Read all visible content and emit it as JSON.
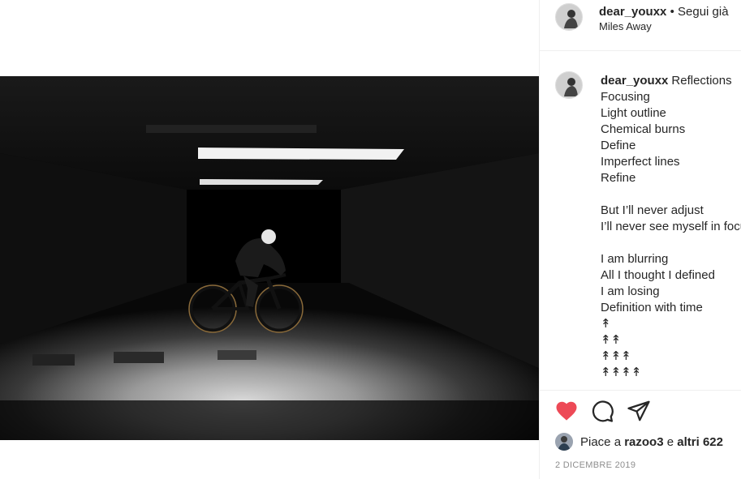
{
  "post": {
    "username": "dear_youxx",
    "separator": "•",
    "follow_label": "Segui già",
    "location": "Miles Away",
    "photo_alt": "cyclist on a bicycle in a dark underground garage"
  },
  "caption": {
    "username": "dear_youxx",
    "text": "Reflections\nFocusing\nLight outline\nChemical burns\nDefine\nImperfect lines\nRefine\n\nBut I’ll never adjust\nI’ll never see myself in focus\n\nI am blurring\nAll I thought I defined\nI am losing\nDefinition with time\n↟\n↟↟\n↟↟↟\n↟↟↟↟"
  },
  "actions": {
    "like_icon": "heart-filled-icon",
    "comment_icon": "comment-icon",
    "share_icon": "share-icon",
    "like_color": "#ed4956"
  },
  "likes": {
    "prefix": "Piace a",
    "user": "razoo3",
    "middle": "e",
    "others": "altri 622"
  },
  "date": "2 DICEMBRE 2019"
}
